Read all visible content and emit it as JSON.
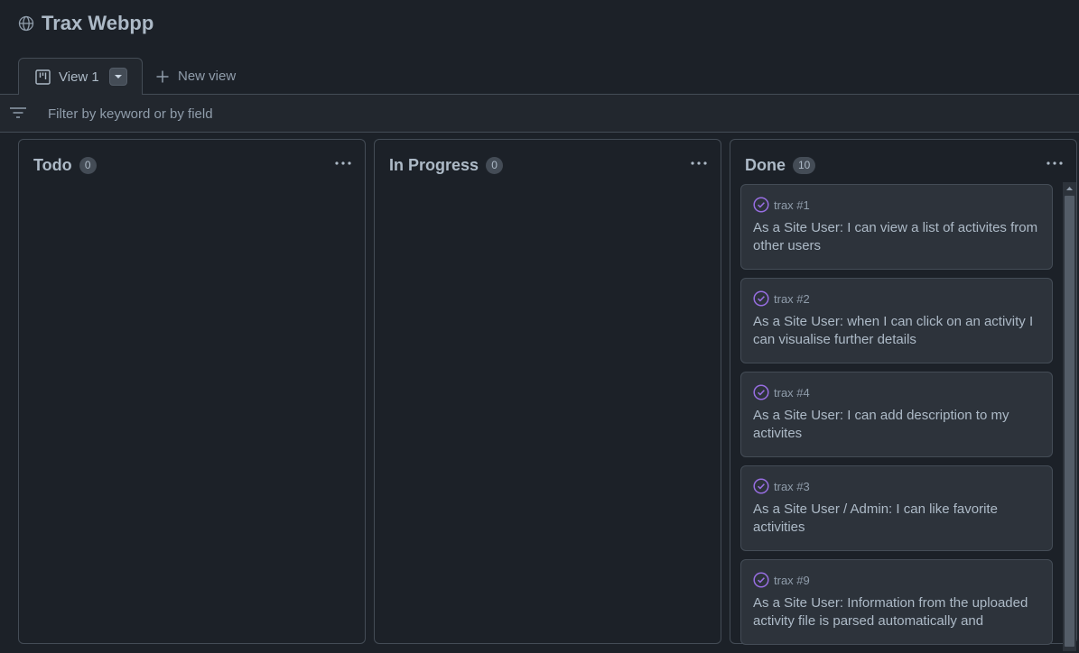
{
  "project": {
    "title": "Trax Webpp",
    "icon": "globe-icon"
  },
  "tabs": {
    "active_label": "View 1",
    "new_view_label": "New view"
  },
  "filter": {
    "placeholder": "Filter by keyword or by field",
    "value": ""
  },
  "columns": [
    {
      "title": "Todo",
      "count": "0"
    },
    {
      "title": "In Progress",
      "count": "0"
    },
    {
      "title": "Done",
      "count": "10"
    }
  ],
  "done_cards": [
    {
      "ref": "trax #1",
      "title": "As a Site User: I can view a list of activites from other users"
    },
    {
      "ref": "trax #2",
      "title": "As a Site User: when I can click on an activity I can visualise further details"
    },
    {
      "ref": "trax #4",
      "title": "As a Site User: I can add description to my activites"
    },
    {
      "ref": "trax #3",
      "title": "As a Site User / Admin: I can like favorite activities"
    },
    {
      "ref": "trax #9",
      "title": "As a Site User: Information from the uploaded activity file is parsed automatically and"
    }
  ],
  "colors": {
    "background": "#1c2128",
    "card": "#2d333b",
    "border": "#444c56",
    "done_icon": "#986ee2"
  }
}
